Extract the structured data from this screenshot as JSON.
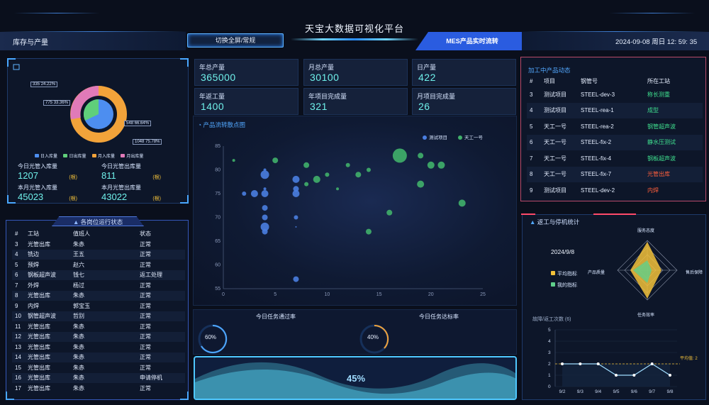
{
  "header": {
    "title": "天宝大数据可视化平台",
    "left_label": "库存与产量",
    "toggle_button": "切换全屏/常规",
    "mes_label": "MES产品实时流转",
    "datetime": "2024-09-08 周日 12: 59: 35"
  },
  "inventory": {
    "donut_labels": [
      {
        "name": "日入库量",
        "value": "335",
        "pct": "24.22%"
      },
      {
        "name": "日出库量",
        "value": "775",
        "pct": "33.36%"
      },
      {
        "name": "月入库量",
        "value": "1048",
        "pct": "75.78%"
      },
      {
        "name": "月出库量",
        "value": "548",
        "pct": "66.64%"
      }
    ],
    "legend": [
      "日入库量",
      "日出库量",
      "月入库量",
      "月出库量"
    ],
    "colors": {
      "day_in": "#4d8ef0",
      "day_out": "#5fcf7a",
      "month_in": "#f2a33a",
      "month_out": "#e07ab8"
    },
    "stats": [
      {
        "label": "今日光管入库量",
        "value": "1207",
        "unit": "(根)"
      },
      {
        "label": "今日光管出库量",
        "value": "811",
        "unit": "(根)"
      },
      {
        "label": "本月光管入库量",
        "value": "45023",
        "unit": "(根)"
      },
      {
        "label": "本月光管出库量",
        "value": "43022",
        "unit": "(根)"
      }
    ]
  },
  "stations": {
    "title": "各岗位运行状态",
    "columns": [
      "#",
      "工站",
      "值班人",
      "状态"
    ],
    "rows": [
      [
        "3",
        "光管出库",
        "朱赤",
        "正常"
      ],
      [
        "4",
        "铣边",
        "王五",
        "正常"
      ],
      [
        "5",
        "预焊",
        "赵六",
        "正常"
      ],
      [
        "6",
        "钢板超声波",
        "钱七",
        "返工处理"
      ],
      [
        "7",
        "外焊",
        "杨过",
        "正常"
      ],
      [
        "8",
        "光管出库",
        "朱赤",
        "正常"
      ],
      [
        "9",
        "内焊",
        "郭宝玉",
        "正常"
      ],
      [
        "10",
        "钢管超声波",
        "哲别",
        "正常"
      ],
      [
        "11",
        "光管出库",
        "朱赤",
        "正常"
      ],
      [
        "12",
        "光管出库",
        "朱赤",
        "正常"
      ],
      [
        "13",
        "光管出库",
        "朱赤",
        "正常"
      ],
      [
        "14",
        "光管出库",
        "朱赤",
        "正常"
      ],
      [
        "15",
        "光管出库",
        "朱赤",
        "正常"
      ],
      [
        "16",
        "光管出库",
        "朱赤",
        "申请停机"
      ],
      [
        "17",
        "光管出库",
        "朱赤",
        "正常"
      ]
    ]
  },
  "kpis": [
    {
      "label": "年总产量",
      "value": "365000"
    },
    {
      "label": "月总产量",
      "value": "30100"
    },
    {
      "label": "日产量",
      "value": "422"
    },
    {
      "label": "年返工量",
      "value": "1400"
    },
    {
      "label": "年项目完成量",
      "value": "321"
    },
    {
      "label": "月项目完成量",
      "value": "26"
    }
  ],
  "scatter": {
    "title": "产品流转散点图",
    "chart_data": {
      "type": "scatter",
      "xlim": [
        0,
        25
      ],
      "ylim": [
        55,
        85
      ],
      "xticks": [
        "0",
        "5",
        "10",
        "15",
        "20",
        "25"
      ],
      "yticks": [
        "55",
        "60",
        "65",
        "70",
        "75",
        "80",
        "85"
      ],
      "series": [
        {
          "name": "测试项目",
          "color": "#4a7ee0",
          "points": [
            [
              4,
              79,
              6
            ],
            [
              4,
              76,
              2
            ],
            [
              4,
              75,
              5
            ],
            [
              4,
              72,
              4
            ],
            [
              4,
              70,
              4
            ],
            [
              4,
              68,
              6
            ],
            [
              4,
              67,
              4
            ],
            [
              3,
              75,
              5
            ],
            [
              2,
              75,
              3
            ],
            [
              7,
              78,
              5
            ],
            [
              7,
              76,
              4
            ],
            [
              7,
              75,
              5
            ],
            [
              7,
              70,
              3
            ],
            [
              7,
              68,
              1
            ],
            [
              7,
              57,
              4
            ],
            [
              4,
              80,
              2
            ]
          ]
        },
        {
          "name": "天工一号",
          "color": "#40b06a",
          "points": [
            [
              1,
              82,
              2
            ],
            [
              5,
              82,
              4
            ],
            [
              8,
              81,
              4
            ],
            [
              10,
              79,
              3
            ],
            [
              9,
              78,
              5
            ],
            [
              12,
              81,
              3
            ],
            [
              13,
              79,
              4
            ],
            [
              14,
              80,
              3
            ],
            [
              17,
              83,
              10
            ],
            [
              19,
              83,
              4
            ],
            [
              20,
              81,
              5
            ],
            [
              21,
              81,
              5
            ],
            [
              19,
              77,
              5
            ],
            [
              16,
              71,
              4
            ],
            [
              14,
              67,
              4
            ],
            [
              23,
              73,
              5
            ],
            [
              8,
              77,
              3
            ],
            [
              11,
              76,
              2
            ]
          ]
        }
      ]
    }
  },
  "task_rates": [
    {
      "label": "今日任务通过率",
      "value": "60%"
    },
    {
      "label": "今日任务达标率",
      "value": "40%"
    }
  ],
  "wave": {
    "value": "45%"
  },
  "processing": {
    "title": "加工中产品动态",
    "columns": [
      "#",
      "项目",
      "钢管号",
      "所在工站"
    ],
    "rows": [
      [
        "3",
        "测试项目",
        "STEEL-dev-3",
        "称长测重"
      ],
      [
        "4",
        "测试项目",
        "STEEL-rea-1",
        "成型"
      ],
      [
        "5",
        "天工一号",
        "STEEL-rea-2",
        "钢管超声波"
      ],
      [
        "6",
        "天工一号",
        "STEEL-fix-2",
        "静水压测试"
      ],
      [
        "7",
        "天工一号",
        "STEEL-fix-4",
        "钢板超声波"
      ],
      [
        "8",
        "天工一号",
        "STEEL-fix-7",
        "光管出库"
      ],
      [
        "9",
        "测试项目",
        "STEEL-dev-2",
        "内焊"
      ]
    ],
    "station_colors": [
      "#3fe08f",
      "#3fe08f",
      "#3fe08f",
      "#3fe08f",
      "#3fe08f",
      "#ff5f3c",
      "#ff5f3c"
    ]
  },
  "rework": {
    "title": "返工与停机统计",
    "date": "2024/9/8",
    "legend": [
      "平均指标",
      "我的指标"
    ],
    "radar_axes": [
      "服务态度",
      "售后保障",
      "任务效率",
      "产品质量"
    ],
    "line_title": "故障/返工次数 (6)",
    "avg_label": "平均值: 2",
    "chart_data": {
      "type": "line",
      "categories": [
        "9/2",
        "9/3",
        "9/4",
        "9/5",
        "9/6",
        "9/7",
        "9/8"
      ],
      "values": [
        2,
        2,
        2,
        1,
        1,
        2,
        1
      ],
      "ylim": [
        0,
        5
      ],
      "yticks": [
        "0",
        "1",
        "2",
        "3",
        "4",
        "5"
      ],
      "average": 2
    }
  }
}
